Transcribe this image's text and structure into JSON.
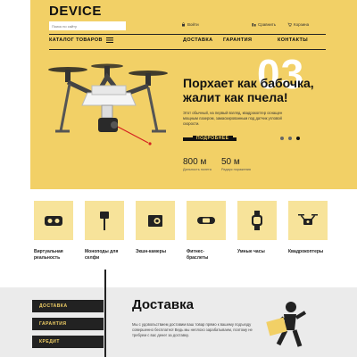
{
  "brand": {
    "logo": "DEVICE"
  },
  "header": {
    "search_placeholder": "Поиск по сайту",
    "login": "Войти",
    "compare": "Сравнить",
    "cart": "Корзина"
  },
  "nav": {
    "catalog": "КАТАЛОГ ТОВАРОВ",
    "items": [
      "ДОСТАВКА",
      "ГАРАНТИЯ",
      "КОНТАКТЫ"
    ]
  },
  "hero": {
    "slide_number": "03",
    "title": "Порхает как бабочка, жалит как пчела!",
    "description": "Этот обычный, на первый взгляд, квадрокоптер оснащен мощным лазером, замаскированным под датчик угловой скорости.",
    "more": "ПОДРОБНЕЕ",
    "stats": [
      {
        "value": "800 м",
        "label": "Дальность полета"
      },
      {
        "value": "50 м",
        "label": "Радиус поражения"
      }
    ]
  },
  "categories": [
    {
      "label": "Виртуальная реальность",
      "icon": "vr-headset-icon"
    },
    {
      "label": "Моноподы для селфи",
      "icon": "selfie-stick-icon"
    },
    {
      "label": "Экшн-камеры",
      "icon": "action-camera-icon"
    },
    {
      "label": "Фитнес-браслеты",
      "icon": "fitness-band-icon"
    },
    {
      "label": "Умные часы",
      "icon": "smartwatch-icon"
    },
    {
      "label": "Квадрокоптеры",
      "icon": "quadcopter-icon"
    }
  ],
  "services": {
    "menu": [
      "ДОСТАВКА",
      "ГАРАНТИЯ",
      "КРЕДИТ"
    ],
    "title": "Доставка",
    "text": "Мы с удовольствием доставим ваш товар прямо к вашему подъезду совершенно бесплатно! Ведь мы неплохо зарабатываем, поэтому не требуем с вас денег за доставку."
  },
  "colors": {
    "accent": "#f2d066",
    "tile": "#f7e39a",
    "dark": "#222222"
  }
}
